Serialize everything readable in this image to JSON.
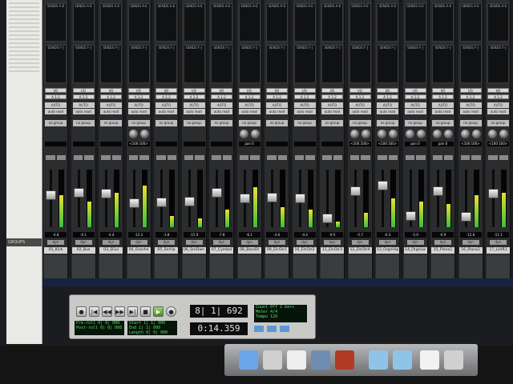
{
  "left_rail": {
    "groups_label": "GROUPS"
  },
  "tracks": [
    {
      "name": "01_Kick",
      "send1": "SENDS A-E",
      "send2": "SENDS F-J",
      "io_in": "I/O",
      "io_out": "A 1-2",
      "auto": "AUTO",
      "auto_mode": "auto read",
      "group": "no group",
      "pan": "",
      "vol": "-4.8",
      "dynamic": "dyn",
      "fader_level": 0.55,
      "meter_level": 0.55,
      "has_knobs": false
    },
    {
      "name": "02_Bus",
      "send1": "SENDS A-E",
      "send2": "SENDS F-J",
      "io_in": "I/O",
      "io_out": "A 1-2",
      "auto": "AUTO",
      "auto_mode": "auto read",
      "group": "no group",
      "pan": "",
      "vol": "-6.1",
      "dynamic": "dyn",
      "fader_level": 0.6,
      "meter_level": 0.45,
      "has_knobs": false
    },
    {
      "name": "03_SGui",
      "send1": "SENDS A-E",
      "send2": "SENDS F-J",
      "io_in": "I/O",
      "io_out": "A 1-2",
      "auto": "AUTO",
      "auto_mode": "auto read",
      "group": "no group",
      "pan": "",
      "vol": "-4.4",
      "dynamic": "dyn",
      "fader_level": 0.58,
      "meter_level": 0.6,
      "has_knobs": false
    },
    {
      "name": "04_Overhe",
      "send1": "SENDS A-E",
      "send2": "SENDS F-J",
      "io_in": "I/O",
      "io_out": "A 1-2",
      "auto": "AUTO",
      "auto_mode": "auto read",
      "group": "no group",
      "pan": "<100 100>",
      "vol": "-12.2",
      "dynamic": "dyn",
      "fader_level": 0.42,
      "meter_level": 0.72,
      "has_knobs": true
    },
    {
      "name": "05_SnrUp",
      "send1": "SENDS A-E",
      "send2": "SENDS F-J",
      "io_in": "I/O",
      "io_out": "A 1-2",
      "auto": "AUTO",
      "auto_mode": "auto read",
      "group": "no group",
      "pan": "",
      "vol": "-3.8",
      "dynamic": "dyn",
      "fader_level": 0.43,
      "meter_level": 0.2,
      "has_knobs": false
    },
    {
      "name": "06_SnrDwn",
      "send1": "SENDS A-E",
      "send2": "SENDS F-J",
      "io_in": "I/O",
      "io_out": "A 1-2",
      "auto": "AUTO",
      "auto_mode": "auto read",
      "group": "no group",
      "pan": "",
      "vol": "-15.9",
      "dynamic": "dyn",
      "fader_level": 0.45,
      "meter_level": 0.15,
      "has_knobs": false
    },
    {
      "name": "07_Cymbal",
      "send1": "SENDS A-E",
      "send2": "SENDS F-J",
      "io_in": "I/O",
      "io_out": "A 1-2",
      "auto": "AUTO",
      "auto_mode": "auto read",
      "group": "no group",
      "pan": "",
      "vol": "-7.8",
      "dynamic": "dyn",
      "fader_level": 0.6,
      "meter_level": 0.3,
      "has_knobs": false
    },
    {
      "name": "08_BassDI",
      "send1": "SENDS A-E",
      "send2": "SENDS F-J",
      "io_in": "I/O",
      "io_out": "A 1-2",
      "auto": "AUTO",
      "auto_mode": "auto read",
      "group": "no group",
      "pan": "pan 0",
      "vol": "-6.1",
      "dynamic": "dyn",
      "fader_level": 0.5,
      "meter_level": 0.7,
      "has_knobs": true
    },
    {
      "name": "09_ElcGtr1",
      "send1": "SENDS A-E",
      "send2": "SENDS F-J",
      "io_in": "I/O",
      "io_out": "A 1-2",
      "auto": "AUTO",
      "auto_mode": "auto read",
      "group": "no group",
      "pan": "",
      "vol": "-4.6",
      "dynamic": "dyn",
      "fader_level": 0.52,
      "meter_level": 0.35,
      "has_knobs": false
    },
    {
      "name": "10_ElcGtr2",
      "send1": "SENDS A-E",
      "send2": "SENDS F-J",
      "io_in": "I/O",
      "io_out": "A 1-2",
      "auto": "AUTO",
      "auto_mode": "auto read",
      "group": "no group",
      "pan": "",
      "vol": "-4.4",
      "dynamic": "dyn",
      "fader_level": 0.5,
      "meter_level": 0.3,
      "has_knobs": false
    },
    {
      "name": "11_ElcGtr3",
      "send1": "SENDS A-E",
      "send2": "SENDS F-J",
      "io_in": "I/O",
      "io_out": "A 1-2",
      "auto": "AUTO",
      "auto_mode": "auto read",
      "group": "no group",
      "pan": "",
      "vol": "-9.5",
      "dynamic": "dyn",
      "fader_level": 0.15,
      "meter_level": 0.1,
      "has_knobs": false
    },
    {
      "name": "12_ElcGtr4",
      "send1": "SENDS A-E",
      "send2": "SENDS F-J",
      "io_in": "I/O",
      "io_out": "A 1-2",
      "auto": "AUTO",
      "auto_mode": "auto read",
      "group": "no group",
      "pan": "<100 100>",
      "vol": "-5.7",
      "dynamic": "dyn",
      "fader_level": 0.62,
      "meter_level": 0.25,
      "has_knobs": true
    },
    {
      "name": "13_OrgnHig",
      "send1": "SENDS A-E",
      "send2": "SENDS F-J",
      "io_in": "I/O",
      "io_out": "A 1-2",
      "auto": "AUTO",
      "auto_mode": "auto read",
      "group": "no group",
      "pan": "<100 100>",
      "vol": "-6.3",
      "dynamic": "dyn",
      "fader_level": 0.72,
      "meter_level": 0.5,
      "has_knobs": true
    },
    {
      "name": "14_OrgnLw",
      "send1": "SENDS A-E",
      "send2": "SENDS F-J",
      "io_in": "I/O",
      "io_out": "A 1-2",
      "auto": "AUTO",
      "auto_mode": "auto read",
      "group": "no group",
      "pan": "pan 0",
      "vol": "-5.0",
      "dynamic": "dyn",
      "fader_level": 0.2,
      "meter_level": 0.45,
      "has_knobs": true
    },
    {
      "name": "15_Piano1",
      "send1": "SENDS A-E",
      "send2": "SENDS F-J",
      "io_in": "I/O",
      "io_out": "A 1-2",
      "auto": "AUTO",
      "auto_mode": "auto read",
      "group": "no group",
      "pan": "pan 0",
      "vol": "-6.9",
      "dynamic": "dyn",
      "fader_level": 0.62,
      "meter_level": 0.4,
      "has_knobs": true
    },
    {
      "name": "16_Piano2",
      "send1": "SENDS A-E",
      "send2": "SENDS F-J",
      "io_in": "I/O",
      "io_out": "A 1-2",
      "auto": "AUTO",
      "auto_mode": "auto read",
      "group": "no group",
      "pan": "<100 100>",
      "vol": "-12.6",
      "dynamic": "dyn",
      "fader_level": 0.18,
      "meter_level": 0.55,
      "has_knobs": true
    },
    {
      "name": "17_LsVR1",
      "send1": "SENDS A-E",
      "send2": "SENDS F-J",
      "io_in": "I/O",
      "io_out": "A 1-2",
      "auto": "AUTO",
      "auto_mode": "auto read",
      "group": "no group",
      "pan": "<100 100>",
      "vol": "-11.1",
      "dynamic": "dyn",
      "fader_level": 0.58,
      "meter_level": 0.6,
      "has_knobs": true
    }
  ],
  "transport": {
    "pre_roll_label": "Pre-roll",
    "post_roll_label": "Post-roll",
    "pre_roll_value": "0| 0| 000",
    "post_roll_value": "0| 0| 000",
    "start_label": "Start",
    "end_label": "End",
    "length_label": "Length",
    "start_value": "1| 1| 000",
    "end_value": "1| 1| 000",
    "length_value": "0| 0| 000",
    "main_counter": "8| 1| 692",
    "sub_counter": "0:14.359",
    "count_off_label": "Count Off",
    "count_off_value": "2 bars",
    "meter_label": "Meter",
    "meter_value": "4/4",
    "tempo_label": "Tempo",
    "tempo_value": "120"
  },
  "dock": {
    "items": [
      "finder-icon",
      "system-preferences-icon",
      "piano-icon",
      "pro-tools-icon",
      "app-icon",
      "folder-icon",
      "folder-icon",
      "document-icon",
      "trash-icon"
    ]
  },
  "colors": {
    "strip": "#2b2c2e",
    "meter_green": "#39c13a",
    "lcd_green": "#55e060",
    "transport_bg": "#c9cac8"
  }
}
